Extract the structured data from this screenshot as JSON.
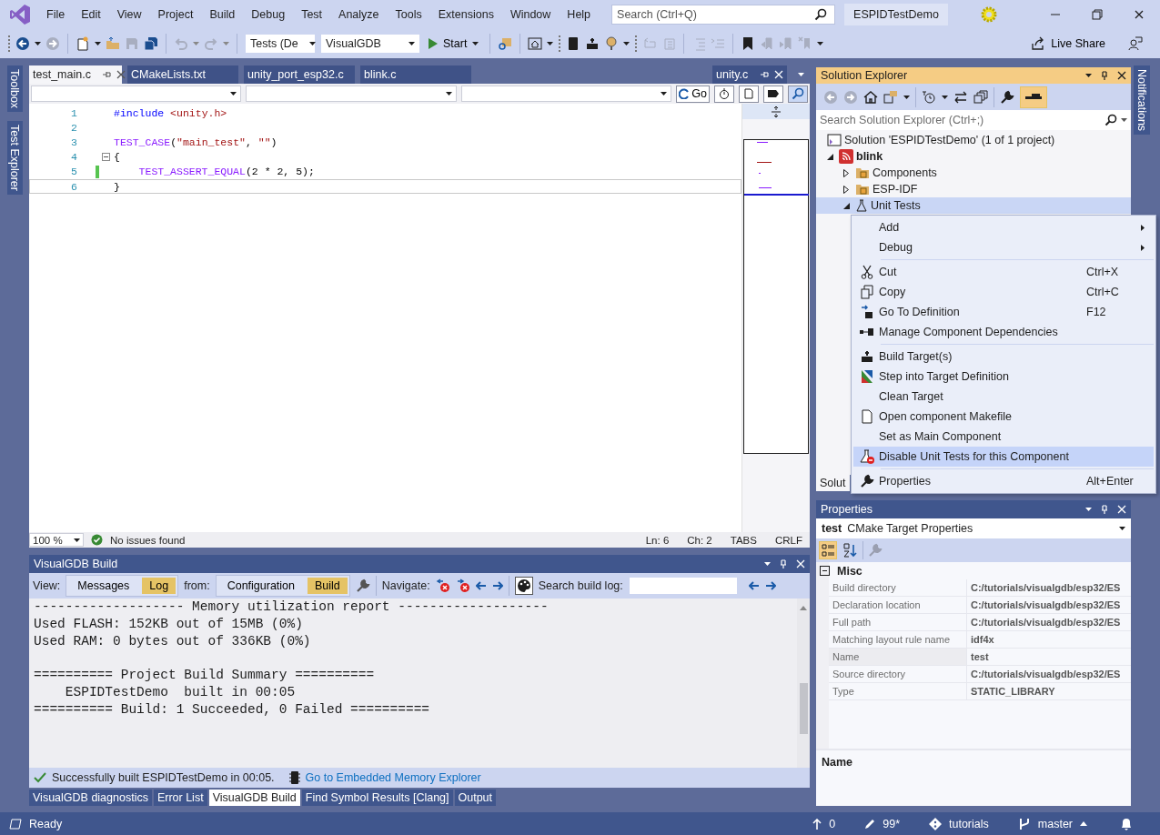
{
  "window": {
    "title": "ESPIDTestDemo",
    "search_placeholder": "Search (Ctrl+Q)"
  },
  "menu": [
    "File",
    "Edit",
    "View",
    "Project",
    "Build",
    "Debug",
    "Test",
    "Analyze",
    "Tools",
    "Extensions",
    "Window",
    "Help"
  ],
  "toolbar": {
    "configuration": "Tests (De",
    "platform": "VisualGDB",
    "start": "Start",
    "live_share": "Live Share"
  },
  "side_tabs": [
    "Toolbox",
    "Test Explorer"
  ],
  "editor": {
    "tabs": [
      {
        "label": "test_main.c",
        "selected": true
      },
      {
        "label": "CMakeLists.txt",
        "selected": false
      },
      {
        "label": "unity_port_esp32.c",
        "selected": false
      },
      {
        "label": "blink.c",
        "selected": false
      }
    ],
    "preview_tab": "unity.c",
    "go_button": "Go",
    "lines": [
      {
        "number": "1",
        "changed": false,
        "foldable": false,
        "current": false,
        "tokens": [
          {
            "kind": "directive",
            "text": "#include"
          },
          {
            "kind": "header",
            "text": " <unity.h>"
          }
        ]
      },
      {
        "number": "2",
        "changed": false,
        "foldable": false,
        "current": false
      },
      {
        "number": "3",
        "changed": false,
        "foldable": false,
        "current": false,
        "tokens": [
          {
            "kind": "macro",
            "text": "TEST_CASE"
          },
          {
            "kind": "plain",
            "text": "("
          },
          {
            "kind": "string",
            "text": "\"main_test\""
          },
          {
            "kind": "plain",
            "text": ", "
          },
          {
            "kind": "string",
            "text": "\"\""
          },
          {
            "kind": "plain",
            "text": ")"
          }
        ]
      },
      {
        "number": "4",
        "changed": false,
        "foldable": true,
        "current": false,
        "tokens": [
          {
            "kind": "plain",
            "text": "{"
          }
        ]
      },
      {
        "number": "5",
        "changed": true,
        "foldable": false,
        "current": false,
        "tokens": [
          {
            "kind": "macro",
            "text": "    TEST_ASSERT_EQUAL"
          },
          {
            "kind": "plain",
            "text": "(2 * 2, 5);"
          }
        ]
      },
      {
        "number": "6",
        "changed": false,
        "foldable": false,
        "current": true,
        "tokens": [
          {
            "kind": "plain",
            "text": "}"
          }
        ]
      }
    ],
    "zoom": "100 %",
    "issues": "No issues found",
    "line": "Ln: 6",
    "column": "Ch: 2",
    "indent": "TABS",
    "line_ending": "CRLF"
  },
  "build": {
    "title": "VisualGDB Build",
    "view_label": "View:",
    "views": [
      {
        "label": "Messages",
        "selected": false
      },
      {
        "label": "Log",
        "selected": true
      }
    ],
    "from_label": "from:",
    "sources": [
      {
        "label": "Configuration",
        "selected": false
      },
      {
        "label": "Build",
        "selected": true
      }
    ],
    "navigate_label": "Navigate:",
    "search_label": "Search build log:",
    "log": [
      [
        "------------------- Memory utilization report -------------------",
        "Used FLASH: 152KB out of 15MB (0%)",
        "Used RAM: 0 bytes out of 336KB (0%)"
      ],
      [
        "========== Project Build Summary ==========",
        "    ESPIDTestDemo  built in 00:05",
        "========== Build: 1 Succeeded, 0 Failed =========="
      ]
    ],
    "message": "Successfully built ESPIDTestDemo in 00:05.",
    "link": "Go to Embedded Memory Explorer"
  },
  "bottom_tabs": [
    {
      "label": "VisualGDB diagnostics",
      "selected": false
    },
    {
      "label": "Error List",
      "selected": false
    },
    {
      "label": "VisualGDB Build",
      "selected": true
    },
    {
      "label": "Find Symbol Results [Clang]",
      "selected": false
    },
    {
      "label": "Output",
      "selected": false
    }
  ],
  "solution": {
    "title": "Solution Explorer",
    "preview_selected_items": true,
    "search_placeholder": "Search Solution Explorer (Ctrl+;)",
    "tree": [
      {
        "label": "Solution 'ESPIDTestDemo' (1 of 1 project)",
        "kind": "solution",
        "selected": false,
        "children": [
          {
            "label": "blink",
            "kind": "project",
            "expanded": true,
            "selected": false,
            "children": [
              {
                "label": "Components",
                "kind": "folder",
                "expanded": false,
                "selected": false
              },
              {
                "label": "ESP-IDF",
                "kind": "folder",
                "expanded": false,
                "selected": false
              },
              {
                "label": "Unit Tests",
                "kind": "tests",
                "expanded": true,
                "selected": true
              }
            ]
          }
        ]
      }
    ],
    "bottom_tab": "Solut"
  },
  "context_menu": [
    {
      "kind": "item",
      "label": "Add",
      "submenu": true,
      "selected": false
    },
    {
      "kind": "item",
      "label": "Debug",
      "submenu": true,
      "selected": false
    },
    {
      "kind": "separator"
    },
    {
      "kind": "item",
      "label": "Cut",
      "shortcut": "Ctrl+X",
      "submenu": false,
      "selected": false
    },
    {
      "kind": "item",
      "label": "Copy",
      "shortcut": "Ctrl+C",
      "submenu": false,
      "selected": false
    },
    {
      "kind": "item",
      "label": "Go To Definition",
      "shortcut": "F12",
      "submenu": false,
      "selected": false
    },
    {
      "kind": "item",
      "label": "Manage Component Dependencies",
      "submenu": false,
      "selected": false
    },
    {
      "kind": "separator"
    },
    {
      "kind": "item",
      "label": "Build Target(s)",
      "submenu": false,
      "selected": false
    },
    {
      "kind": "item",
      "label": "Step into Target Definition",
      "submenu": false,
      "selected": false
    },
    {
      "kind": "item",
      "label": "Clean Target",
      "submenu": false,
      "selected": false
    },
    {
      "kind": "item",
      "label": "Open component Makefile",
      "submenu": false,
      "selected": false
    },
    {
      "kind": "item",
      "label": "Set as Main Component",
      "submenu": false,
      "selected": false
    },
    {
      "kind": "item",
      "label": "Disable Unit Tests for this Component",
      "submenu": false,
      "selected": true
    },
    {
      "kind": "separator"
    },
    {
      "kind": "item",
      "label": "Properties",
      "shortcut": "Alt+Enter",
      "submenu": false,
      "selected": false
    }
  ],
  "properties": {
    "title": "Properties",
    "object": "test",
    "object_type": "CMake Target Properties",
    "categorized": true,
    "category": {
      "label": "Misc",
      "expanded": true
    },
    "rows": [
      {
        "name": "Build directory",
        "value": "C:/tutorials/visualgdb/esp32/ES",
        "selected": false
      },
      {
        "name": "Declaration location",
        "value": "C:/tutorials/visualgdb/esp32/ES",
        "selected": false
      },
      {
        "name": "Full path",
        "value": "C:/tutorials/visualgdb/esp32/ES",
        "selected": false
      },
      {
        "name": "Matching layout rule name",
        "value": "idf4x",
        "selected": false
      },
      {
        "name": "Name",
        "value": "test",
        "selected": true
      },
      {
        "name": "Source directory",
        "value": "C:/tutorials/visualgdb/esp32/ES",
        "selected": false
      },
      {
        "name": "Type",
        "value": "STATIC_LIBRARY",
        "selected": false
      }
    ],
    "description_title": "Name"
  },
  "notifications": "Notifications",
  "status": {
    "text": "Ready",
    "outgoing": "0",
    "changes": "99*",
    "repository": "tutorials",
    "branch": "master"
  }
}
